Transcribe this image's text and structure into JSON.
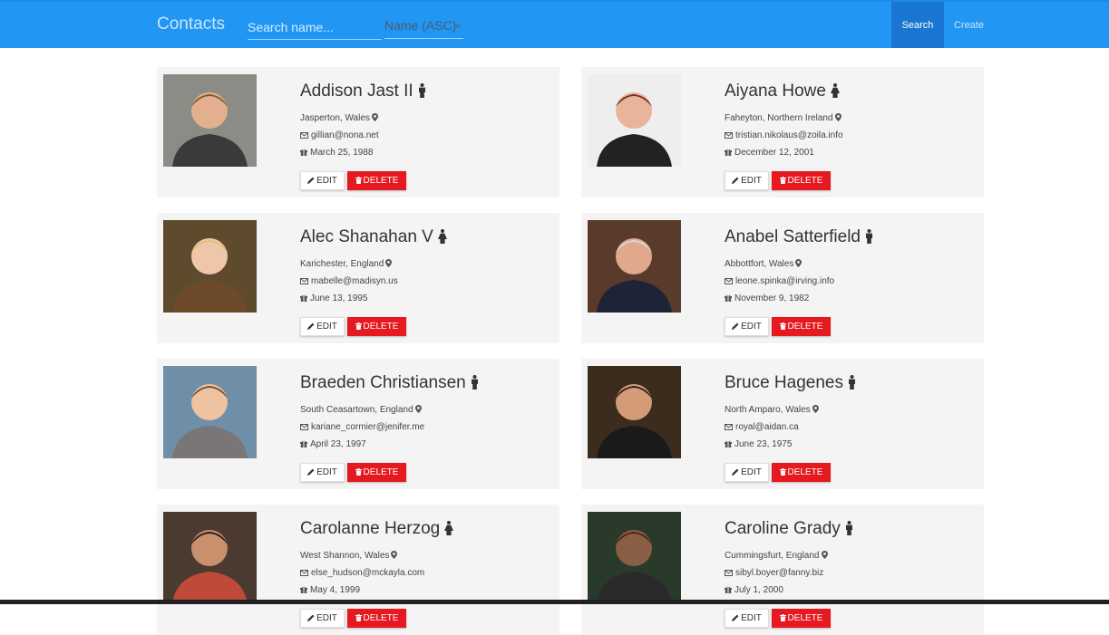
{
  "navbar": {
    "brand": "Contacts",
    "search_placeholder": "Search name...",
    "sort_value": "Name (ASC)",
    "search_label": "Search",
    "create_label": "Create",
    "color": "#2196f3"
  },
  "buttons": {
    "edit_label": "EDIT",
    "delete_label": "DELETE",
    "delete_color": "#e5191f"
  },
  "contacts": [
    {
      "name": "Addison Jast II",
      "gender": "male-icon",
      "location": "Jasperton, Wales",
      "email": "gillian@nona.net",
      "birthday": "March 25, 1988"
    },
    {
      "name": "Aiyana Howe",
      "gender": "female-icon",
      "location": "Faheyton, Northern Ireland",
      "email": "tristian.nikolaus@zoila.info",
      "birthday": "December 12, 2001"
    },
    {
      "name": "Alec Shanahan V",
      "gender": "female-icon",
      "location": "Karichester, England",
      "email": "mabelle@madisyn.us",
      "birthday": "June 13, 1995"
    },
    {
      "name": "Anabel Satterfield",
      "gender": "male-icon",
      "location": "Abbottfort, Wales",
      "email": "leone.spinka@irving.info",
      "birthday": "November 9, 1982"
    },
    {
      "name": "Braeden Christiansen",
      "gender": "male-icon",
      "location": "South Ceasartown, England",
      "email": "kariane_cormier@jenifer.me",
      "birthday": "April 23, 1997"
    },
    {
      "name": "Bruce Hagenes",
      "gender": "male-icon",
      "location": "North Amparo, Wales",
      "email": "royal@aidan.ca",
      "birthday": "June 23, 1975"
    },
    {
      "name": "Carolanne Herzog",
      "gender": "female-icon",
      "location": "West Shannon, Wales",
      "email": "else_hudson@mckayla.com",
      "birthday": "May 4, 1999"
    },
    {
      "name": "Caroline Grady",
      "gender": "male-icon",
      "location": "Cummingsfurt, England",
      "email": "sibyl.boyer@fanny.biz",
      "birthday": "July 1, 2000"
    }
  ]
}
